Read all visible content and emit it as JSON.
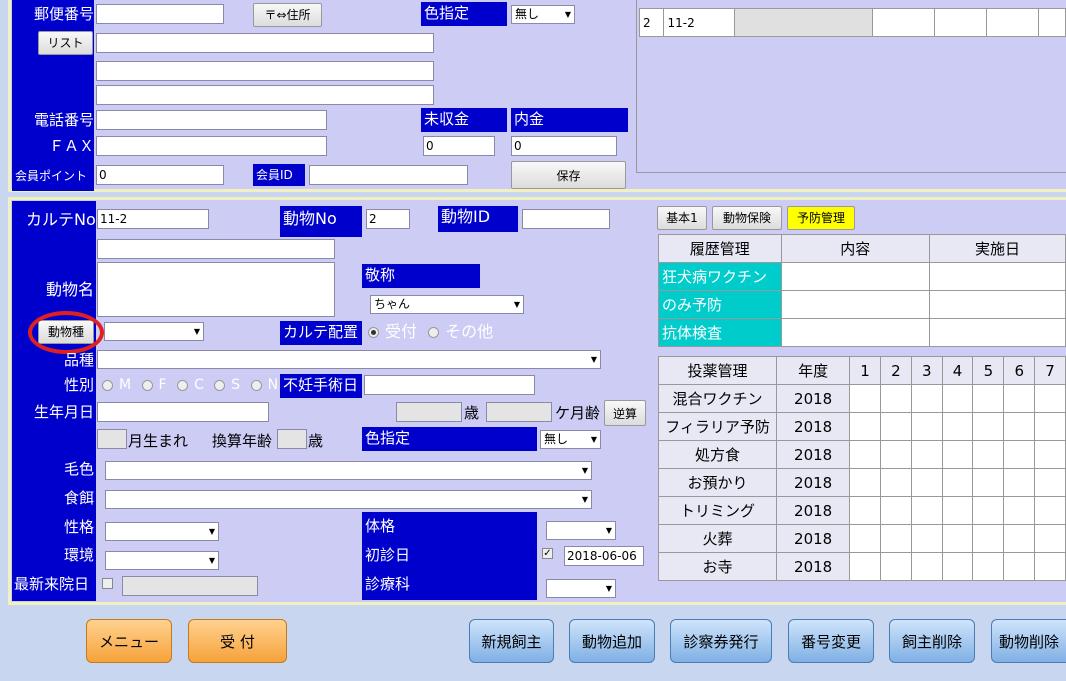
{
  "top": {
    "postal_label": "郵便番号",
    "postal_value": "",
    "postal_btn": "〒⇔住所",
    "color_label": "色指定",
    "color_value": "無し",
    "list_btn": "リスト",
    "phone_label": "電話番号",
    "fax_label": "ＦＡＸ",
    "points_label": "会員ポイント",
    "points_value": "0",
    "member_id_label": "会員ID",
    "unpaid_label": "未収金",
    "unpaid_value": "0",
    "deposit_label": "内金",
    "deposit_value": "0",
    "save_btn": "保存",
    "list_row": {
      "no": "2",
      "id": "11-2"
    }
  },
  "karte": {
    "karte_no_label": "カルテNo",
    "karte_no_value": "11-2",
    "animal_no_label": "動物No",
    "animal_no_value": "2",
    "animal_id_label": "動物ID",
    "animal_name_label": "動物名",
    "honorific_label": "敬称",
    "honorific_value": "ちゃん",
    "species_btn": "動物種",
    "karte_place_label": "カルテ配置",
    "karte_place_options": [
      "受付",
      "その他"
    ],
    "breed_label": "品種",
    "sex_label": "性別",
    "sex_options": [
      "M",
      "F",
      "C",
      "S",
      "N"
    ],
    "sterile_label": "不妊手術日",
    "birth_label": "生年月日",
    "age_years_unit": "歳",
    "age_months_unit": "ケ月齢",
    "reverse_btn": "逆算",
    "month_born": "月生まれ",
    "converted_age": "換算年齢",
    "converted_unit": "歳",
    "color_spec_label": "色指定",
    "color_spec_value": "無し",
    "fur_label": "毛色",
    "food_label": "食餌",
    "temperament_label": "性格",
    "physique_label": "体格",
    "env_label": "環境",
    "first_visit_label": "初診日",
    "first_visit_value": "2018-06-06",
    "last_visit_label": "最新来院日",
    "department_label": "診療科"
  },
  "tabs": [
    "基本1",
    "動物保険",
    "予防管理"
  ],
  "history": {
    "headers": [
      "履歴管理",
      "内容",
      "実施日"
    ],
    "rows": [
      "狂犬病ワクチン",
      "のみ予防",
      "抗体検査"
    ]
  },
  "dosing": {
    "headers": [
      "投薬管理",
      "年度",
      "1",
      "2",
      "3",
      "4",
      "5",
      "6",
      "7"
    ],
    "rows": [
      {
        "name": "混合ワクチン",
        "year": "2018"
      },
      {
        "name": "フィラリア予防",
        "year": "2018"
      },
      {
        "name": "処方食",
        "year": "2018"
      },
      {
        "name": "お預かり",
        "year": "2018"
      },
      {
        "name": "トリミング",
        "year": "2018"
      },
      {
        "name": "火葬",
        "year": "2018"
      },
      {
        "name": "お寺",
        "year": "2018"
      }
    ]
  },
  "bottom_buttons": {
    "menu": "メニュー",
    "reception": "受 付",
    "new_owner": "新規飼主",
    "add_animal": "動物追加",
    "ticket": "診察券発行",
    "renumber": "番号変更",
    "delete_owner": "飼主削除",
    "delete_animal": "動物削除"
  },
  "colors": {
    "blue_label": "#0000cc",
    "panel": "#ccccf4",
    "cyan": "#00cccc",
    "highlight_circle": "#e02020"
  }
}
